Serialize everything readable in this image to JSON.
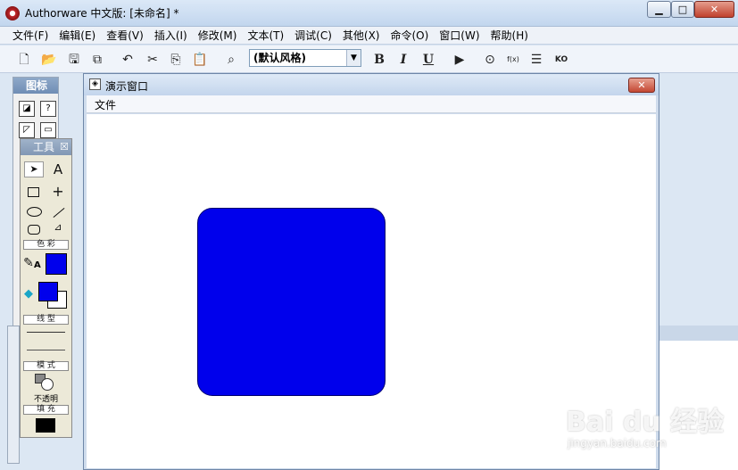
{
  "window": {
    "title": "Authorware 中文版: [未命名] *",
    "min": "▁",
    "max": "□",
    "close": "✕"
  },
  "menubar": [
    "文件(F)",
    "编辑(E)",
    "查看(V)",
    "插入(I)",
    "修改(M)",
    "文本(T)",
    "调试(C)",
    "其他(X)",
    "命令(O)",
    "窗口(W)",
    "帮助(H)"
  ],
  "toolbar": {
    "style_value": "(默认风格)",
    "combo_arrow": "▼",
    "bold": "B",
    "italic": "I",
    "underline": "U",
    "fx_label": "f(x)",
    "ko_label": "KO"
  },
  "icon_palette": {
    "title": "图标"
  },
  "tool_palette": {
    "title": "工具",
    "close": "☒",
    "arrow": "➤",
    "text_tool": "A",
    "color_section": "色 彩",
    "line_section": "线 型",
    "mode_section": "模 式",
    "mode_value": "不透明",
    "fill_section": "填 充",
    "pen_label": "A",
    "colors": {
      "line": "#0000ec",
      "fill_fg": "#0000ec",
      "fill_bg": "#ffffff",
      "fill_pattern": "#000000"
    }
  },
  "presentation": {
    "title": "演示窗口",
    "file_menu": "文件",
    "close": "✕",
    "shape_color": "#0000ec"
  },
  "watermark": {
    "logo": "Bai du 经验",
    "url": "jingyan.baidu.com"
  }
}
